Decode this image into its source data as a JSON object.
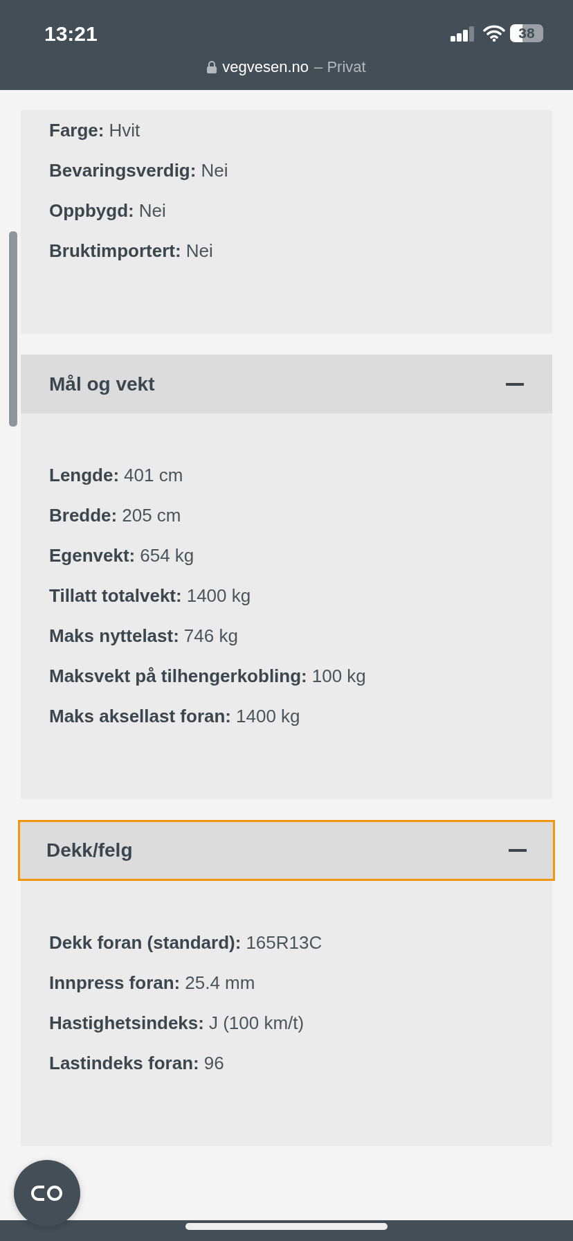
{
  "status_bar": {
    "time": "13:21",
    "battery": "38"
  },
  "address_bar": {
    "domain": "vegvesen.no",
    "mode": "– Privat"
  },
  "sections": [
    {
      "rows": [
        {
          "label": "Farge:",
          "value": "Hvit"
        },
        {
          "label": "Bevaringsverdig:",
          "value": "Nei"
        },
        {
          "label": "Oppbygd:",
          "value": "Nei"
        },
        {
          "label": "Bruktimportert:",
          "value": "Nei"
        }
      ]
    },
    {
      "title": "Mål og vekt",
      "expanded": true,
      "focused": false,
      "rows": [
        {
          "label": "Lengde:",
          "value": "401 cm"
        },
        {
          "label": "Bredde:",
          "value": "205 cm"
        },
        {
          "label": "Egenvekt:",
          "value": "654 kg"
        },
        {
          "label": "Tillatt totalvekt:",
          "value": "1400 kg"
        },
        {
          "label": "Maks nyttelast:",
          "value": "746 kg"
        },
        {
          "label": "Maksvekt på tilhengerkobling:",
          "value": "100 kg"
        },
        {
          "label": "Maks aksellast foran:",
          "value": "1400 kg"
        }
      ]
    },
    {
      "title": "Dekk/felg",
      "expanded": true,
      "focused": true,
      "rows": [
        {
          "label": "Dekk foran (standard):",
          "value": "165R13C"
        },
        {
          "label": "Innpress foran:",
          "value": "25.4 mm"
        },
        {
          "label": "Hastighetsindeks:",
          "value": "J (100 km/t)"
        },
        {
          "label": "Lastindeks foran:",
          "value": "96"
        }
      ]
    }
  ]
}
